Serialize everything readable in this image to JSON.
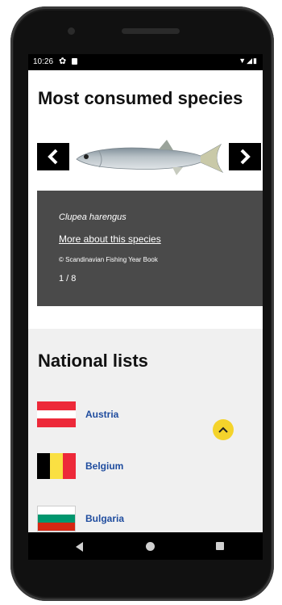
{
  "status": {
    "time": "10:26",
    "icons_right": "▼◢▮"
  },
  "species_section": {
    "title": "Most consumed species",
    "species_name": "Clupea harengus",
    "more_link": "More about this species",
    "copyright": "© Scandinavian Fishing Year Book",
    "counter": "1 / 8"
  },
  "national_lists": {
    "title": "National lists",
    "countries": [
      {
        "name": "Austria",
        "flag_colors": [
          "#ed2939",
          "#ffffff",
          "#ed2939"
        ]
      },
      {
        "name": "Belgium",
        "flag_colors": [
          "#000000",
          "#fae042",
          "#ed2939"
        ]
      },
      {
        "name": "Bulgaria",
        "flag_colors": [
          "#ffffff",
          "#00966e",
          "#d62612"
        ]
      }
    ]
  },
  "colors": {
    "accent_yellow": "#f4d32b",
    "link_blue": "#1f4c9e",
    "panel_gray": "#4a4a4a"
  },
  "icons": [
    "settings-icon",
    "sd-card-icon",
    "wifi-icon",
    "signal-icon",
    "battery-icon",
    "chevron-left-icon",
    "chevron-right-icon",
    "chevron-up-icon",
    "nav-back-icon",
    "nav-home-icon",
    "nav-recent-icon"
  ]
}
